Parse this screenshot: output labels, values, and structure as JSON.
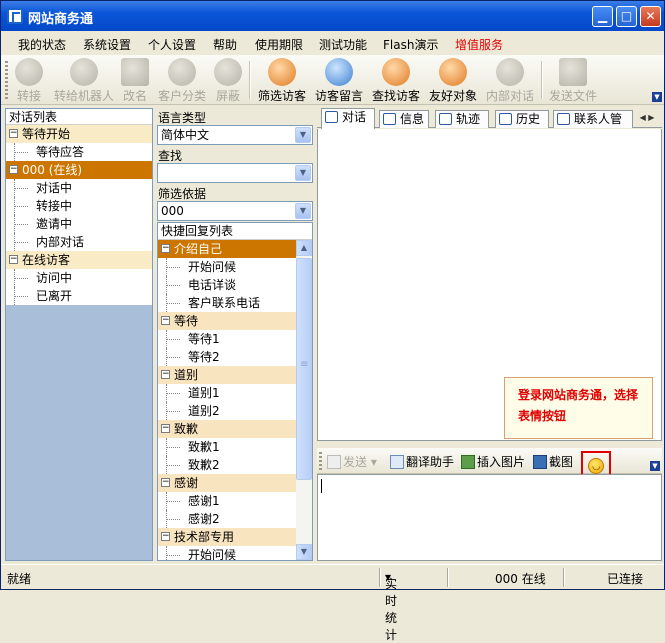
{
  "window": {
    "title": "网站商务通"
  },
  "menu": [
    "我的状态",
    "系统设置",
    "个人设置",
    "帮助",
    "使用期限",
    "测试功能",
    "Flash演示",
    "增值服务"
  ],
  "menu_highlight_color": "#e00000",
  "toolbar": {
    "items": [
      {
        "label": "转接",
        "enabled": false,
        "icon": "transfer-icon"
      },
      {
        "label": "转给机器人",
        "enabled": false,
        "icon": "robot-icon"
      },
      {
        "label": "改名",
        "enabled": false,
        "icon": "rename-icon"
      },
      {
        "label": "客户分类",
        "enabled": false,
        "icon": "customer-category-icon"
      },
      {
        "label": "屏蔽",
        "enabled": false,
        "icon": "block-icon"
      },
      {
        "label": "筛选访客",
        "enabled": true,
        "icon": "filter-visitor-icon"
      },
      {
        "label": "访客留言",
        "enabled": true,
        "icon": "visitor-message-icon"
      },
      {
        "label": "查找访客",
        "enabled": true,
        "icon": "find-visitor-icon"
      },
      {
        "label": "友好对象",
        "enabled": true,
        "icon": "friendly-object-icon"
      },
      {
        "label": "内部对话",
        "enabled": false,
        "icon": "internal-chat-icon"
      },
      {
        "label": "发送文件",
        "enabled": false,
        "icon": "send-file-icon"
      }
    ]
  },
  "left": {
    "header": "对话列表",
    "groups": [
      {
        "label": "等待开始",
        "selected": false,
        "children": [
          "等待应答"
        ]
      },
      {
        "label": "000 (在线)",
        "selected": true,
        "children": [
          "对话中",
          "转接中",
          "邀请中",
          "内部对话"
        ]
      },
      {
        "label": "在线访客",
        "selected": false,
        "children": [
          "访问中",
          "已离开"
        ]
      }
    ]
  },
  "middle": {
    "language_label": "语言类型",
    "language_value": "简体中文",
    "search_label": "查找",
    "search_value": "",
    "filter_label": "筛选依据",
    "filter_value": "000",
    "quick_reply_header": "快捷回复列表",
    "groups": [
      {
        "label": "介绍自己",
        "selected": true,
        "children": [
          "开始问候",
          "电话详谈",
          "客户联系电话"
        ]
      },
      {
        "label": "等待",
        "selected": false,
        "children": [
          "等待1",
          "等待2"
        ]
      },
      {
        "label": "道别",
        "selected": false,
        "children": [
          "道别1",
          "道别2"
        ]
      },
      {
        "label": "致歉",
        "selected": false,
        "children": [
          "致歉1",
          "致歉2"
        ]
      },
      {
        "label": "感谢",
        "selected": false,
        "children": [
          "感谢1",
          "感谢2"
        ]
      },
      {
        "label": "技术部专用",
        "selected": false,
        "children": [
          "开始问候"
        ]
      }
    ]
  },
  "chat": {
    "tabs": [
      "对话",
      "信息",
      "轨迹",
      "历史",
      "联系人管理"
    ],
    "active_tab": 0,
    "callout": {
      "line1": "登录网站商务通，选择",
      "line2": "表情按钮"
    },
    "send_toolbar": {
      "send": "发送",
      "translate": "翻译助手",
      "insert_image": "插入图片",
      "screenshot": "截图",
      "emoji_icon": "smiley-icon"
    },
    "input_value": ""
  },
  "status": {
    "left": "就绪",
    "stats": "实时统计",
    "user": "000 在线",
    "connection": "已连接"
  },
  "colors": {
    "selected_orange": "#cc7600",
    "group_bg": "#f9ebc5",
    "callout_text": "#e00000"
  }
}
